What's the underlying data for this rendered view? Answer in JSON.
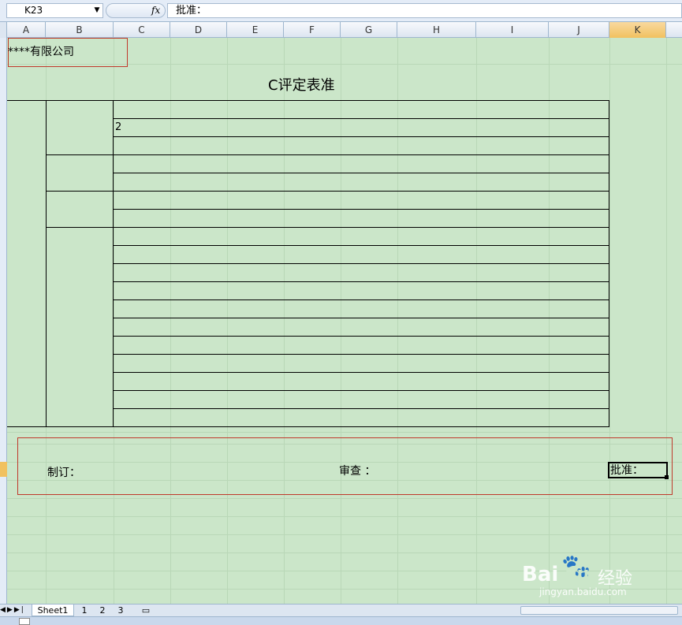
{
  "formula_bar": {
    "name_box": "K23",
    "fx_label": "fx",
    "formula": "批准："
  },
  "columns": [
    "A",
    "B",
    "C",
    "D",
    "E",
    "F",
    "G",
    "H",
    "I",
    "J",
    "K"
  ],
  "selected_column": "K",
  "sheet": {
    "company": "****有限公司",
    "title": "C评定表准",
    "cell_value": "2",
    "footer": {
      "prepared": "制订：",
      "review": "审查 ：",
      "approve": "批准："
    }
  },
  "tabs": {
    "sheet1": "Sheet1",
    "t1": "1",
    "t2": "2",
    "t3": "3"
  },
  "watermark": {
    "brand": "Bai",
    "brand2": "du",
    "cn": "经验",
    "url": "jingyan.baidu.com"
  },
  "colors": {
    "sheet_bg": "#cbe6c9",
    "selection_accent": "#f1c15f",
    "red_box": "#c0392b"
  }
}
